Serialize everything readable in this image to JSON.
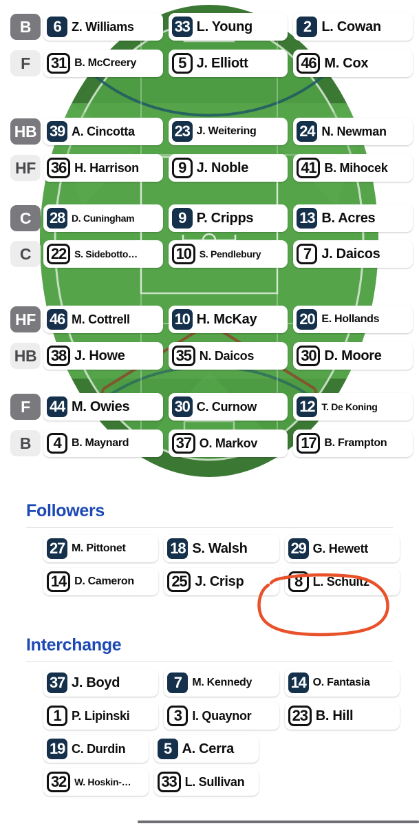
{
  "ground": {
    "field_colors": {
      "outer_ring": "#3b7833",
      "inner_field": "#55a44a",
      "field_mid": "#4d9c43",
      "line": "#ffffff",
      "arc_line": "#1f5a63",
      "goal_square": "#8a4a2a"
    },
    "rows": [
      {
        "position": "B",
        "team_style": "navy",
        "label_style": "dark",
        "players": [
          {
            "number": "6",
            "name": "Z. Williams",
            "size": "s18"
          },
          {
            "number": "33",
            "name": "L. Young",
            "size": "s20"
          },
          {
            "number": "2",
            "name": "L. Cowan",
            "size": "s20"
          }
        ]
      },
      {
        "position": "F",
        "team_style": "outline",
        "label_style": "light",
        "players": [
          {
            "number": "31",
            "name": "B. McCreery",
            "size": "s16"
          },
          {
            "number": "5",
            "name": "J. Elliott",
            "size": "s20"
          },
          {
            "number": "46",
            "name": "M. Cox",
            "size": "s20"
          }
        ]
      },
      {
        "position": "HB",
        "team_style": "navy",
        "label_style": "dark",
        "players": [
          {
            "number": "39",
            "name": "A. Cincotta",
            "size": "s18"
          },
          {
            "number": "23",
            "name": "J. Weitering",
            "size": "s17"
          },
          {
            "number": "24",
            "name": "N. Newman",
            "size": "s18"
          }
        ]
      },
      {
        "position": "HF",
        "team_style": "outline",
        "label_style": "light",
        "players": [
          {
            "number": "36",
            "name": "H. Harrison",
            "size": "s18"
          },
          {
            "number": "9",
            "name": "J. Noble",
            "size": "s20"
          },
          {
            "number": "41",
            "name": "B. Mihocek",
            "size": "s18"
          }
        ]
      },
      {
        "position": "C",
        "team_style": "navy",
        "label_style": "dark",
        "players": [
          {
            "number": "28",
            "name": "D. Cuningham",
            "size": "s15"
          },
          {
            "number": "9",
            "name": "P. Cripps",
            "size": "s20"
          },
          {
            "number": "13",
            "name": "B. Acres",
            "size": "s20"
          }
        ]
      },
      {
        "position": "C",
        "team_style": "outline",
        "label_style": "light",
        "players": [
          {
            "number": "22",
            "name": "S. Sidebotto…",
            "size": "s15"
          },
          {
            "number": "10",
            "name": "S. Pendlebury",
            "size": "s15"
          },
          {
            "number": "7",
            "name": "J. Daicos",
            "size": "s20"
          }
        ]
      },
      {
        "position": "HF",
        "team_style": "navy",
        "label_style": "dark",
        "players": [
          {
            "number": "46",
            "name": "M. Cottrell",
            "size": "s18"
          },
          {
            "number": "10",
            "name": "H. McKay",
            "size": "s20"
          },
          {
            "number": "20",
            "name": "E. Hollands",
            "size": "s16"
          }
        ]
      },
      {
        "position": "HB",
        "team_style": "outline",
        "label_style": "light",
        "players": [
          {
            "number": "38",
            "name": "J. Howe",
            "size": "s20"
          },
          {
            "number": "35",
            "name": "N. Daicos",
            "size": "s18"
          },
          {
            "number": "30",
            "name": "D. Moore",
            "size": "s20"
          }
        ]
      },
      {
        "position": "F",
        "team_style": "navy",
        "label_style": "dark",
        "players": [
          {
            "number": "44",
            "name": "M. Owies",
            "size": "s20"
          },
          {
            "number": "30",
            "name": "C. Curnow",
            "size": "s18"
          },
          {
            "number": "12",
            "name": "T. De Koning",
            "size": "s15"
          }
        ]
      },
      {
        "position": "B",
        "team_style": "outline",
        "label_style": "light",
        "players": [
          {
            "number": "4",
            "name": "B. Maynard",
            "size": "s17"
          },
          {
            "number": "37",
            "name": "O. Markov",
            "size": "s18"
          },
          {
            "number": "17",
            "name": "B. Frampton",
            "size": "s16"
          }
        ]
      }
    ]
  },
  "followers": {
    "title": "Followers",
    "rows": [
      {
        "team_style": "navy",
        "players": [
          {
            "number": "27",
            "name": "M. Pittonet",
            "size": "s17"
          },
          {
            "number": "18",
            "name": "S. Walsh",
            "size": "s20"
          },
          {
            "number": "29",
            "name": "G. Hewett",
            "size": "s18"
          }
        ]
      },
      {
        "team_style": "outline",
        "players": [
          {
            "number": "14",
            "name": "D. Cameron",
            "size": "s17"
          },
          {
            "number": "25",
            "name": "J. Crisp",
            "size": "s20"
          },
          {
            "number": "8",
            "name": "L. Schultz",
            "size": "s18"
          }
        ]
      }
    ]
  },
  "interchange": {
    "title": "Interchange",
    "rows": [
      {
        "team_style": "navy",
        "players": [
          {
            "number": "37",
            "name": "J. Boyd",
            "size": "s20"
          },
          {
            "number": "7",
            "name": "M. Kennedy",
            "size": "s17"
          },
          {
            "number": "14",
            "name": "O. Fantasia",
            "size": "s17"
          }
        ]
      },
      {
        "team_style": "outline",
        "players": [
          {
            "number": "1",
            "name": "P. Lipinski",
            "size": "s18"
          },
          {
            "number": "3",
            "name": "I. Quaynor",
            "size": "s18"
          },
          {
            "number": "23",
            "name": "B. Hill",
            "size": "s20"
          }
        ]
      },
      {
        "team_style": "navy",
        "players": [
          {
            "number": "19",
            "name": "C. Durdin",
            "size": "s19"
          },
          {
            "number": "5",
            "name": "A. Cerra",
            "size": "s20"
          }
        ]
      },
      {
        "team_style": "outline",
        "players": [
          {
            "number": "32",
            "name": "W. Hoskin-…",
            "size": "s15"
          },
          {
            "number": "33",
            "name": "L. Sullivan",
            "size": "s19"
          }
        ]
      }
    ]
  },
  "annotation": {
    "shape": "hand-drawn-ellipse",
    "color": "#e8512a",
    "targets": "8 L. Schultz"
  }
}
